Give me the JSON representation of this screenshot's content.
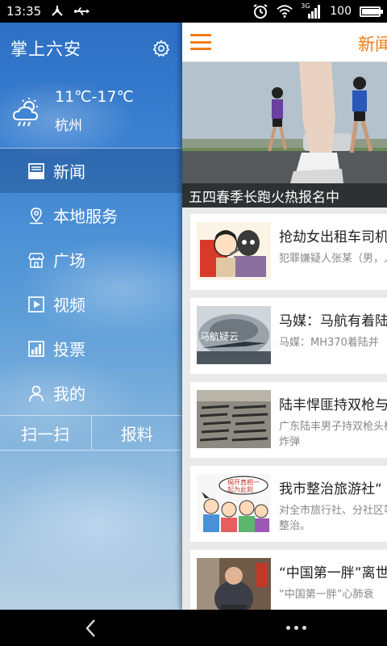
{
  "status_bar": {
    "time": "13:35",
    "battery_text": "100",
    "battery_level": 1.0,
    "network": "3G"
  },
  "drawer": {
    "app_title": "掌上六安",
    "weather": {
      "temperature": "11℃-17℃",
      "city": "杭州",
      "icon": "cloud-sun-rain-icon"
    },
    "menu": [
      {
        "label": "新闻",
        "icon": "news-icon",
        "active": true
      },
      {
        "label": "本地服务",
        "icon": "location-pin-icon",
        "active": false
      },
      {
        "label": "广场",
        "icon": "store-icon",
        "active": false
      },
      {
        "label": "视频",
        "icon": "video-play-icon",
        "active": false
      },
      {
        "label": "投票",
        "icon": "bar-chart-icon",
        "active": false
      },
      {
        "label": "我的",
        "icon": "user-icon",
        "active": false
      }
    ],
    "actions": {
      "scan": "扫一扫",
      "report": "报料"
    }
  },
  "main": {
    "title": "新闻",
    "hero_caption": "五四春季长跑火热报名中",
    "news": [
      {
        "title": "抢劫女出租车司机",
        "summary": "犯罪嫌疑人张某（男，人）。"
      },
      {
        "title": "马媒：马航有着陆",
        "summary": "马媒：MH370着陆并"
      },
      {
        "title": "陆丰悍匪持双枪与",
        "summary": "广东陆丰男子持双枪头枪战并投掷炸弹"
      },
      {
        "title": "我市整治旅游社“",
        "summary": "对全市旅行社、分社区等单位进行整治。"
      },
      {
        "title": "“中国第一胖”离世",
        "summary": "“中国第一胖”心肺衰"
      }
    ],
    "thumb_texts": {
      "mh370": "马航疑云",
      "cartoon_bubble": "揭开真相一起为此刻"
    }
  },
  "colors": {
    "accent": "#f07c12",
    "drawer_top": "#2c6fc4",
    "drawer_bottom": "#b8d0e3"
  }
}
